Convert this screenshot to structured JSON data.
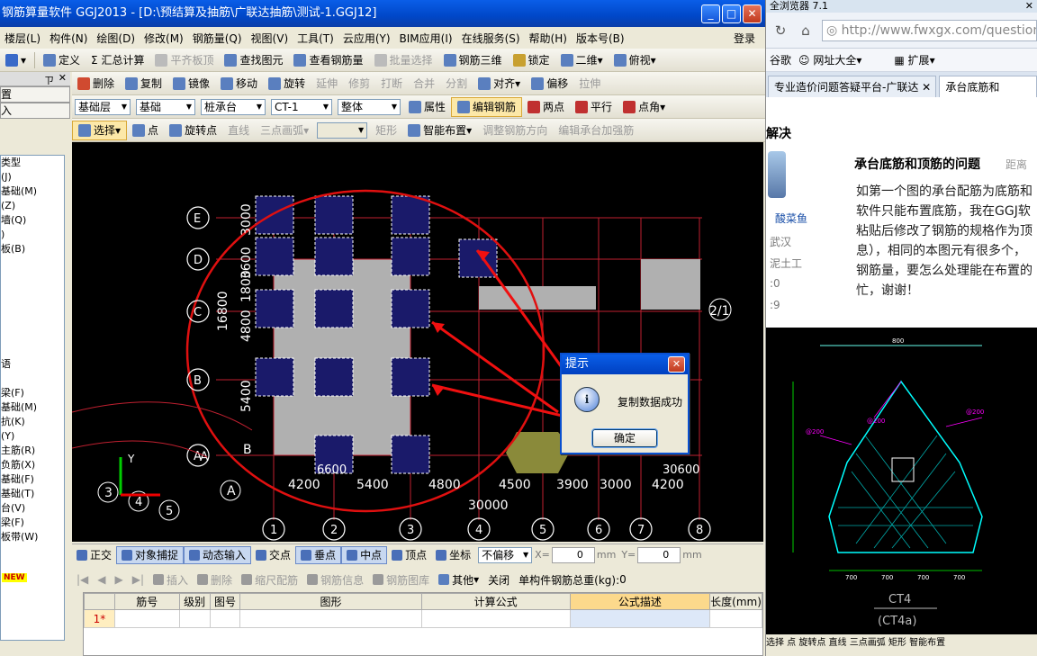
{
  "window": {
    "title": "钢筋算量软件 GGJ2013 - [D:\\预结算及抽筋\\广联达抽筋\\测试-1.GGJ12]",
    "min": "_",
    "max": "□",
    "close": "✕"
  },
  "menu": {
    "items": [
      "楼层(L)",
      "构件(N)",
      "绘图(D)",
      "修改(M)",
      "钢筋量(Q)",
      "视图(V)",
      "工具(T)",
      "云应用(Y)",
      "BIM应用(I)",
      "在线服务(S)",
      "帮助(H)",
      "版本号(B)"
    ],
    "login": "登录"
  },
  "toolbar1": {
    "define": "定义",
    "sum": "Σ 汇总计算",
    "flat": "平齐板顶",
    "find": "查找图元",
    "view_steel": "查看钢筋量",
    "batch": "批量选择",
    "steel3d": "钢筋三维",
    "lock": "锁定",
    "view2d": "二维",
    "top": "俯视"
  },
  "toolbar2": {
    "delete": "删除",
    "copy": "复制",
    "mirror": "镜像",
    "move": "移动",
    "rotate": "旋转",
    "extend": "延伸",
    "trim": "修剪",
    "break": "打断",
    "merge": "合并",
    "split": "分割",
    "align": "对齐",
    "offset": "偏移",
    "stretch": "拉伸"
  },
  "toolbar3": {
    "layer": "基础层",
    "type": "基础",
    "sub": "桩承台",
    "name": "CT-1",
    "whole": "整体",
    "prop": "属性",
    "edit": "编辑钢筋",
    "two_point": "两点",
    "parallel": "平行",
    "point_angle": "点角"
  },
  "toolbar4": {
    "select": "选择",
    "point": "点",
    "rot_point": "旋转点",
    "line": "直线",
    "arc": "三点画弧",
    "rect": "矩形",
    "smart": "智能布置",
    "adjust": "调整钢筋方向",
    "edit_cap": "编辑承台加强筋"
  },
  "left_panel": {
    "pin": "ㄗ",
    "close": "✕",
    "btn1": "置",
    "btn2": "入",
    "tree": [
      "类型",
      "(J)",
      "基础(M)",
      "(Z)",
      "墙(Q)",
      ")",
      "板(B)",
      "",
      "",
      "",
      "",
      "",
      "",
      "",
      "语",
      "",
      "梁(F)",
      "基础(M)",
      "抗(K)",
      "(Y)",
      "主筋(R)",
      "负筋(X)",
      "基础(F)",
      "基础(T)",
      "台(V)",
      "梁(F)",
      "板带(W)"
    ],
    "new_badge": "NEW"
  },
  "canvas": {
    "axis_letters": [
      "E",
      "D",
      "C",
      "B",
      "A"
    ],
    "axis_numbers": [
      "1",
      "2",
      "3",
      "4",
      "5",
      "6",
      "7",
      "8"
    ],
    "left_dims": [
      "3000",
      "3600",
      "1800",
      "4800",
      "5400"
    ],
    "total_left": "16800",
    "bottom_dims": [
      "4200",
      "5400",
      "4800",
      "4500",
      "3900",
      "3000",
      "4200"
    ],
    "total_bottom": "30000",
    "extra_labels": [
      "2/1",
      "A",
      "B",
      "3",
      "4",
      "5",
      "A",
      "6600",
      "30600"
    ],
    "coord_y": "Y"
  },
  "dialog": {
    "title": "提示",
    "message": "复制数据成功",
    "ok": "确定",
    "close": "✕",
    "info": "i"
  },
  "snapbar": {
    "ortho": "正交",
    "snap": "对象捕捉",
    "dyn": "动态输入",
    "cross": "交点",
    "perp": "垂点",
    "mid": "中点",
    "vertex": "顶点",
    "coord": "坐标",
    "offset_mode": "不偏移",
    "x_label": "X=",
    "x_val": "0",
    "x_unit": "mm",
    "y_label": "Y=",
    "y_val": "0",
    "y_unit": "mm"
  },
  "rebar_toolbar": {
    "insert": "插入",
    "del": "删除",
    "scale": "缩尺配筋",
    "info": "钢筋信息",
    "lib": "钢筋图库",
    "other": "其他",
    "close": "关闭",
    "total_label": "单构件钢筋总重(kg):",
    "total": "0"
  },
  "grid": {
    "headers": [
      "筋号",
      "级别",
      "图号",
      "图形",
      "计算公式",
      "公式描述",
      "长度(mm)"
    ],
    "row1": "1*"
  },
  "browser": {
    "title": "全浏览器 7.1",
    "url": "http://www.fwxgx.com/question",
    "bookmarks": [
      "谷歌",
      "网址大全",
      "扩展"
    ],
    "tabs": [
      "专业造价问题答疑平台-广联达",
      "承台底筋和"
    ],
    "section": "解决",
    "question_title": "承台底筋和顶筋的问题",
    "question_tag": "距离",
    "user": "酸菜鱼",
    "meta": [
      "武汉",
      "泥土工",
      ":0",
      ":9"
    ],
    "body": [
      "如第一个图的承台配筋为底筋和",
      "软件只能布置底筋，我在GGJ软",
      "粘贴后修改了钢筋的规格作为顶",
      "息），相同的本图元有很多个，",
      "钢筋量，要怎么处理能在布置的",
      "忙，谢谢！"
    ],
    "cad_label1": "CT4",
    "cad_label2": "(CT4a)",
    "cad_dims": [
      "800",
      "700",
      "700",
      "700",
      "700"
    ],
    "status": "选择  点  旋转点   直线  三点画弧  矩形  智能布置"
  }
}
